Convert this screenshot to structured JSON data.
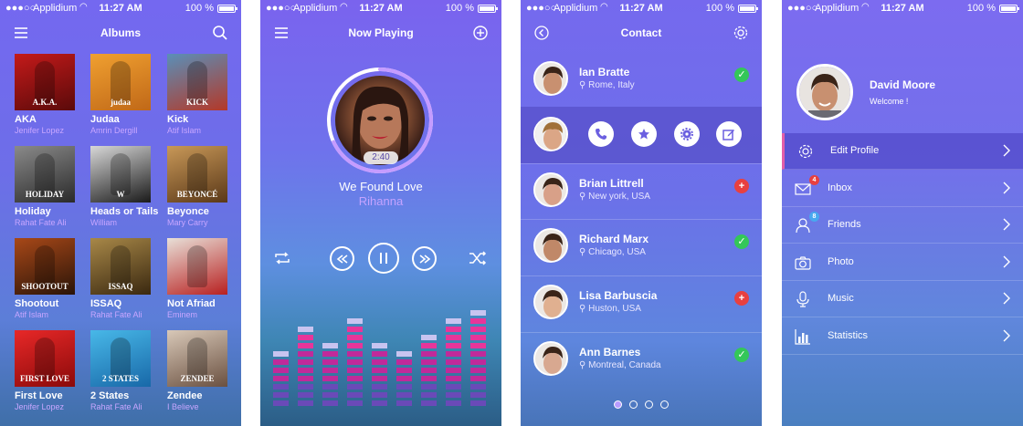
{
  "status": {
    "carrier": "Applidium",
    "time": "11:27 AM",
    "battery": "100 %"
  },
  "albums_screen": {
    "title": "Albums",
    "albums": [
      {
        "title": "AKA",
        "artist": "Jenifer Lopez",
        "art_text": "A.K.A.",
        "color1": "#c41a1a",
        "color2": "#5a0a0a"
      },
      {
        "title": "Judaa",
        "artist": "Amrin Dergill",
        "art_text": "judaa",
        "color1": "#f0a030",
        "color2": "#c06818"
      },
      {
        "title": "Kick",
        "artist": "Atif Islam",
        "art_text": "KICK",
        "color1": "#5a8fb8",
        "color2": "#b43828"
      },
      {
        "title": "Holiday",
        "artist": "Rahat Fate Ali",
        "art_text": "HOLIDAY",
        "color1": "#8a8a8a",
        "color2": "#2a2a2a"
      },
      {
        "title": "Heads or Tails",
        "artist": "William",
        "art_text": "W",
        "color1": "#d8d8d8",
        "color2": "#1a1a1a"
      },
      {
        "title": "Beyonce",
        "artist": "Mary Carry",
        "art_text": "BEYONCÉ",
        "color1": "#c89858",
        "color2": "#5a3818"
      },
      {
        "title": "Shootout",
        "artist": "Atif Islam",
        "art_text": "SHOOTOUT",
        "color1": "#a84818",
        "color2": "#2a1408"
      },
      {
        "title": "ISSAQ",
        "artist": "Rahat Fate Ali",
        "art_text": "ISSAQ",
        "color1": "#a88848",
        "color2": "#3a2810"
      },
      {
        "title": "Not Afriad",
        "artist": "Eminem",
        "art_text": "",
        "color1": "#e8e0d8",
        "color2": "#b82020"
      },
      {
        "title": "First Love",
        "artist": "Jenifer Lopez",
        "art_text": "FIRST LOVE",
        "color1": "#e82828",
        "color2": "#8a0a0a"
      },
      {
        "title": "2 States",
        "artist": "Rahat Fate Ali",
        "art_text": "2 STATES",
        "color1": "#48b8e8",
        "color2": "#1868a8"
      },
      {
        "title": "Zendee",
        "artist": "I Believe",
        "art_text": "ZENDEE",
        "color1": "#d8c8b8",
        "color2": "#6a5040"
      }
    ]
  },
  "now_playing": {
    "title": "Now Playing",
    "time": "2:40",
    "progress": 0.68,
    "song": "We Found Love",
    "artist": "Rihanna",
    "eq_levels": [
      7,
      10,
      8,
      11,
      8,
      7,
      9,
      11,
      12
    ],
    "eq_max": 12
  },
  "contacts": {
    "title": "Contact",
    "list": [
      {
        "name": "Ian Bratte",
        "location": "Rome, Italy",
        "status": "added",
        "skin": "#c89070"
      },
      {
        "name": "Brian Littrell",
        "location": "New york, USA",
        "status": "add",
        "skin": "#d8a088"
      },
      {
        "name": "Richard Marx",
        "location": "Chicago, USA",
        "status": "added",
        "skin": "#c08868"
      },
      {
        "name": "Lisa Barbuscia",
        "location": "Huston, USA",
        "status": "add",
        "skin": "#e0b090"
      },
      {
        "name": "Ann Barnes",
        "location": "Montreal, Canada",
        "status": "added",
        "skin": "#d8a890"
      }
    ],
    "status_symbols": {
      "added": "✓",
      "add": "+"
    },
    "status_colors": {
      "added": "#34c759",
      "add": "#e84040"
    },
    "page_count": 4,
    "active_page": 0
  },
  "profile": {
    "name": "David Moore",
    "welcome": "Welcome !",
    "menu": [
      {
        "label": "Edit Profile",
        "icon": "gear-icon",
        "badge": ""
      },
      {
        "label": "Inbox",
        "icon": "mail-icon",
        "badge": "4"
      },
      {
        "label": "Friends",
        "icon": "user-icon",
        "badge": "8"
      },
      {
        "label": "Photo",
        "icon": "camera-icon",
        "badge": ""
      },
      {
        "label": "Music",
        "icon": "microphone-icon",
        "badge": ""
      },
      {
        "label": "Statistics",
        "icon": "bar-chart-icon",
        "badge": ""
      }
    ]
  }
}
